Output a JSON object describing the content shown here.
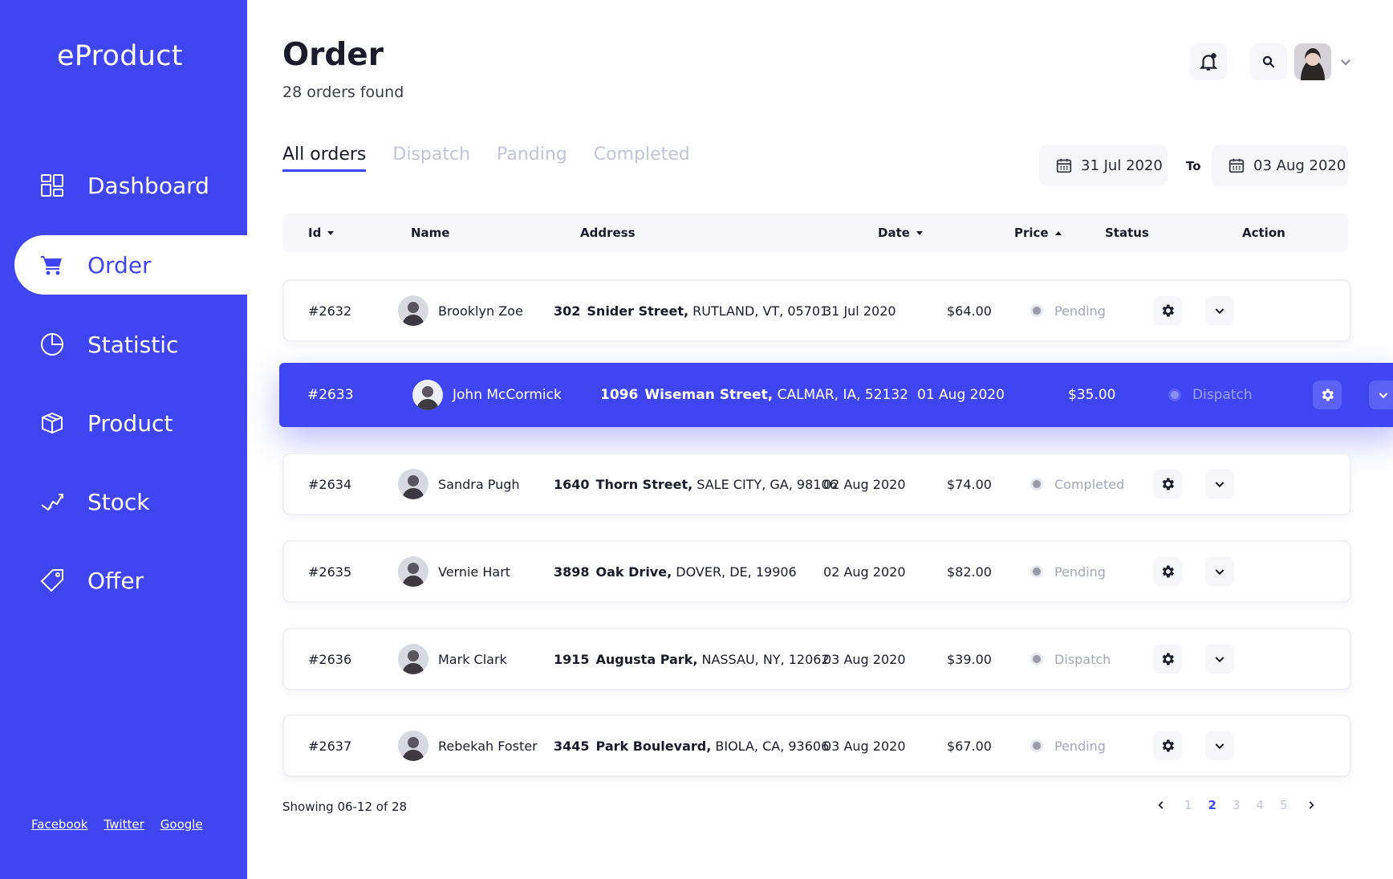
{
  "brand": "eProduct",
  "nav": [
    {
      "label": "Dashboard",
      "icon": "dashboard-icon"
    },
    {
      "label": "Order",
      "icon": "cart-icon",
      "active": true
    },
    {
      "label": "Statistic",
      "icon": "pie-chart-icon"
    },
    {
      "label": "Product",
      "icon": "box-icon"
    },
    {
      "label": "Stock",
      "icon": "stock-icon"
    },
    {
      "label": "Offer",
      "icon": "tag-icon"
    }
  ],
  "footer_links": [
    "Facebook",
    "Twitter",
    "Google"
  ],
  "header": {
    "title": "Order",
    "subtitle": "28 orders found"
  },
  "tabs": [
    "All orders",
    "Dispatch",
    "Panding",
    "Completed"
  ],
  "date_range": {
    "from": "31 Jul 2020",
    "to_label": "To",
    "to": "03 Aug 2020"
  },
  "columns": [
    "Id",
    "Name",
    "Address",
    "Date",
    "Price",
    "Status",
    "Action"
  ],
  "rows": [
    {
      "id": "#2632",
      "name": "Brooklyn Zoe",
      "num": "302",
      "street": "Snider Street,",
      "rest": "RUTLAND, VT, 05701",
      "date": "31 Jul 2020",
      "price": "$64.00",
      "status": "Pending"
    },
    {
      "id": "#2633",
      "name": "John McCormick",
      "num": "1096",
      "street": "Wiseman Street,",
      "rest": "CALMAR, IA, 52132",
      "date": "01 Aug 2020",
      "price": "$35.00",
      "status": "Dispatch"
    },
    {
      "id": "#2634",
      "name": "Sandra Pugh",
      "num": "1640",
      "street": "Thorn Street,",
      "rest": "SALE CITY, GA, 98106",
      "date": "02 Aug 2020",
      "price": "$74.00",
      "status": "Completed"
    },
    {
      "id": "#2635",
      "name": "Vernie Hart",
      "num": "3898",
      "street": "Oak Drive,",
      "rest": "DOVER, DE, 19906",
      "date": "02 Aug 2020",
      "price": "$82.00",
      "status": "Pending"
    },
    {
      "id": "#2636",
      "name": "Mark Clark",
      "num": "1915",
      "street": "Augusta Park,",
      "rest": "NASSAU, NY, 12062",
      "date": "03 Aug 2020",
      "price": "$39.00",
      "status": "Dispatch"
    },
    {
      "id": "#2637",
      "name": "Rebekah Foster",
      "num": "3445",
      "street": "Park Boulevard,",
      "rest": "BIOLA, CA, 93606",
      "date": "03 Aug 2020",
      "price": "$67.00",
      "status": "Pending"
    }
  ],
  "showing": "Showing 06-12 of 28",
  "pages": [
    "1",
    "2",
    "3",
    "4",
    "5"
  ],
  "current_page": "2",
  "colors": {
    "accent": "#3f45f0",
    "muted": "#c2c4d6"
  }
}
